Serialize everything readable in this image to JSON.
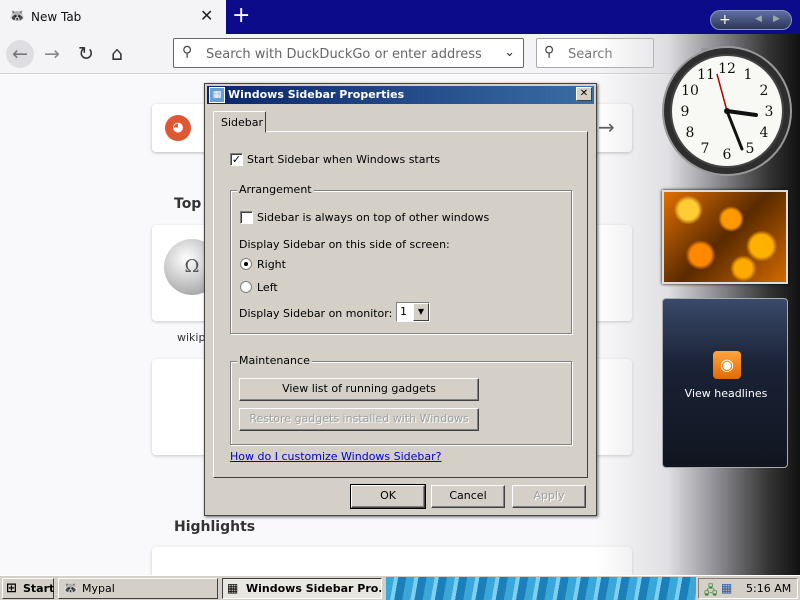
{
  "browser": {
    "tab_title": "New Tab",
    "tab_close_glyph": "✕",
    "new_tab_glyph": "+",
    "url_placeholder": "Search with DuckDuckGo or enter address",
    "search_placeholder": "Search",
    "top_sites_heading": "Top S",
    "wiki_label": "wikipe",
    "highlights_heading": "Highlights"
  },
  "dialog": {
    "title": "Windows Sidebar Properties",
    "tab_label": "Sidebar",
    "start_sidebar_label": "Start Sidebar when Windows starts",
    "start_sidebar_checked": true,
    "arrangement_title": "Arrangement",
    "always_on_top_label": "Sidebar is always on top of other windows",
    "always_on_top_checked": false,
    "side_label": "Display Sidebar on this side of screen:",
    "right_label": "Right",
    "left_label": "Left",
    "selected_side": "Right",
    "monitor_label": "Display Sidebar on monitor:",
    "monitor_value": "1",
    "maintenance_title": "Maintenance",
    "view_gadgets_label": "View list of running gadgets",
    "restore_gadgets_label": "Restore gadgets installed with Windows",
    "help_link": "How do I customize Windows Sidebar?",
    "ok_label": "OK",
    "cancel_label": "Cancel",
    "apply_label": "Apply"
  },
  "sidebar": {
    "feed_label": "View headlines",
    "clock_time": "5:16"
  },
  "taskbar": {
    "start_label": "Start",
    "task_mypal": "Mypal",
    "task_sidebar": "Windows Sidebar Pro...",
    "clock": "5:16 AM"
  },
  "colors": {
    "tab_strip": "#0c0c8a",
    "dialog_face": "#d4d0c8",
    "title_bar": "#0a246a",
    "link": "#0000cc"
  }
}
